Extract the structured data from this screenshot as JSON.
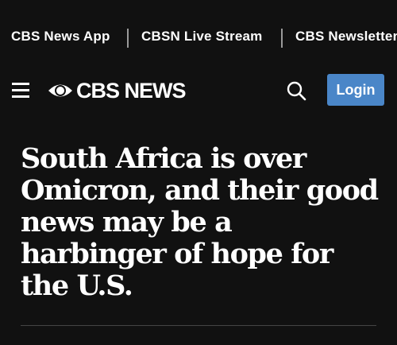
{
  "top_links": [
    {
      "label": "CBS News App"
    },
    {
      "label": "CBSN Live Stream"
    },
    {
      "label": "CBS Newsletters"
    }
  ],
  "nav": {
    "logo_text": "CBS NEWS",
    "menu_icon": "hamburger-menu-icon",
    "search_icon": "search-icon",
    "login_label": "Login"
  },
  "article": {
    "headline": "South Africa is over Omicron, and their good news may be a harbinger of hope for the U.S."
  },
  "colors": {
    "background": "#111111",
    "text": "#ffffff",
    "login_button": "#4a86c8",
    "separator": "#9a9a9a"
  }
}
